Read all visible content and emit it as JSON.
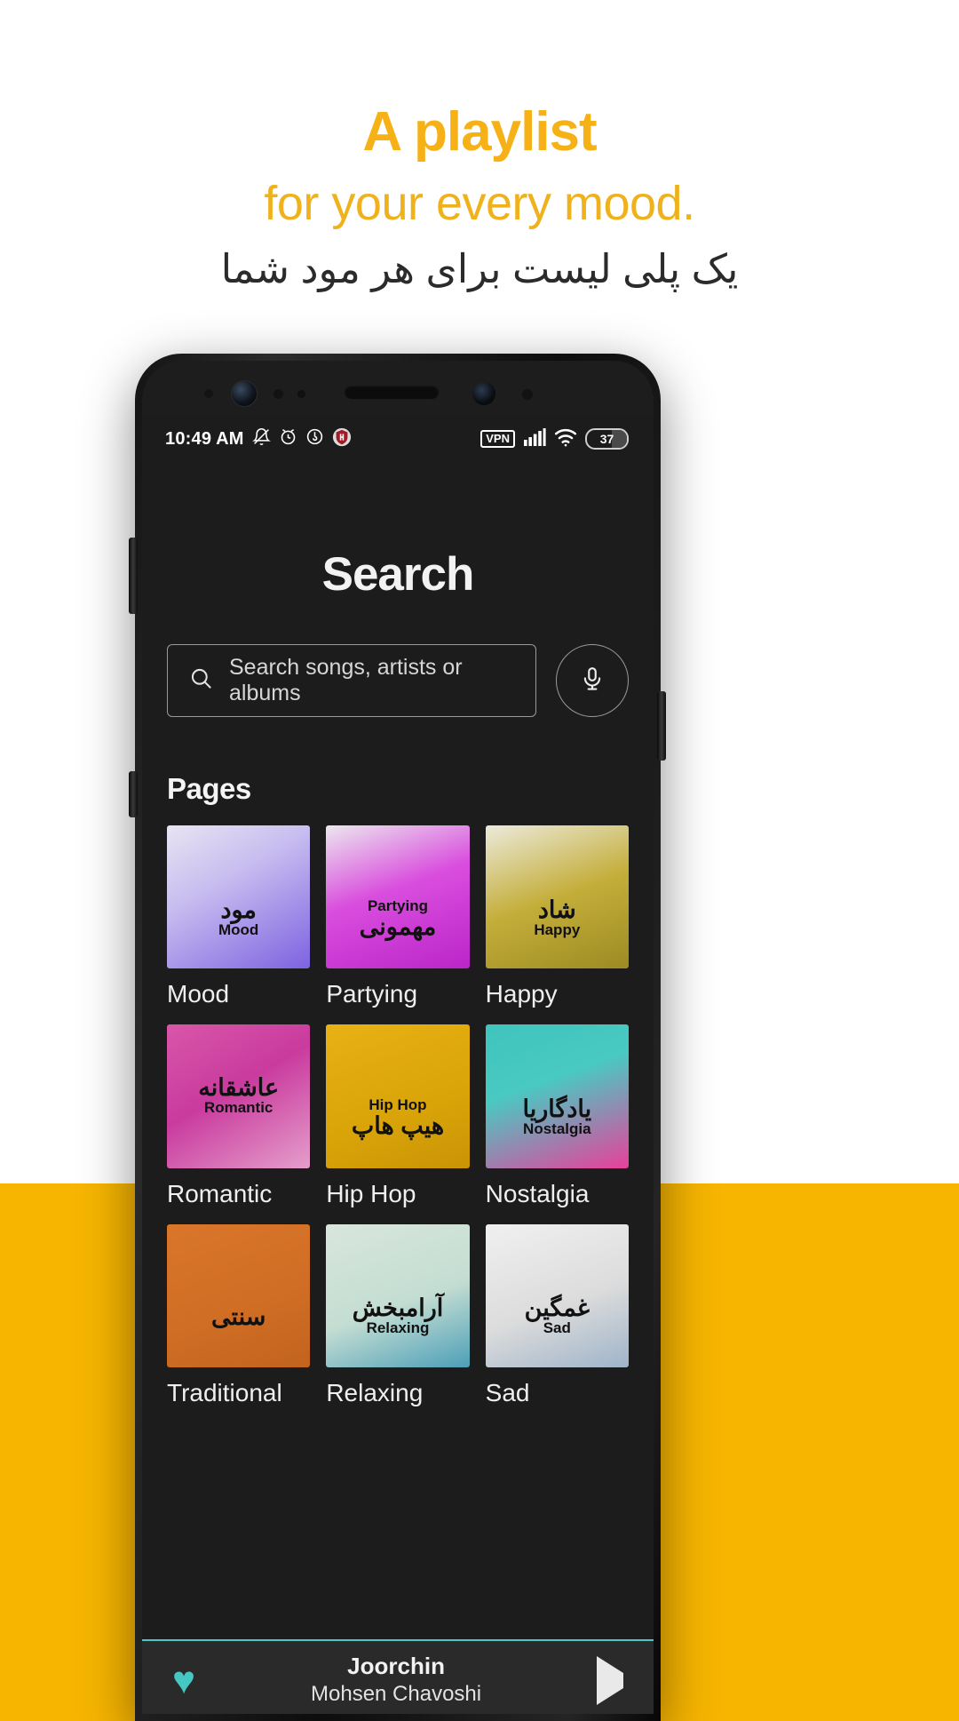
{
  "promo": {
    "line1": "A playlist",
    "line2": "for your every mood.",
    "line_fa": "یک پلی لیست برای هر مود شما",
    "accent_color": "#f5b116",
    "band_color": "#f7b500"
  },
  "status_bar": {
    "time": "10:49 AM",
    "icons_left": [
      "bell-muted-icon",
      "alarm-icon",
      "music-circle-icon",
      "shield-icon"
    ],
    "vpn_label": "VPN",
    "icons_right": [
      "signal-icon",
      "wifi-icon"
    ],
    "battery_percent": "37"
  },
  "screen": {
    "title": "Search",
    "search": {
      "placeholder": "Search songs, artists or albums",
      "value": "",
      "icon": "search-icon",
      "mic_icon": "microphone-icon"
    },
    "section_title": "Pages",
    "cards": [
      {
        "label": "Mood",
        "fa": "مود",
        "en": "Mood",
        "bg": "linear-gradient(150deg,#e8e4f2 0%,#c8bdf0 38%,#7d63e0 100%)",
        "shift": false
      },
      {
        "label": "Partying",
        "fa": "مهمونی",
        "en": "Partying",
        "bg": "linear-gradient(160deg,#ece7ee 0%,#d94ede 45%,#bb25c9 100%)",
        "shift": true
      },
      {
        "label": "Happy",
        "fa": "شاد",
        "en": "Happy",
        "bg": "linear-gradient(160deg,#eceadb 0%,#c4ae3a 50%,#9d8b23 100%)",
        "shift": false
      },
      {
        "label": "Romantic",
        "fa": "عاشقانه",
        "en": "Romantic",
        "bg": "linear-gradient(150deg,#d956a8 0%,#c93b9e 45%,#e59ecb 100%)",
        "shift": false
      },
      {
        "label": "Hip Hop",
        "fa": "هیپ هاپ",
        "en": "Hip Hop",
        "bg": "linear-gradient(160deg,#e8b114 0%,#d9a408 60%,#c99406 100%)",
        "shift": true
      },
      {
        "label": "Nostalgia",
        "fa": "یادگاریا",
        "en": "Nostalgia",
        "bg": "linear-gradient(160deg,#3fc4bd 0%,#49c9c2 40%,#e8409a 100%)",
        "shift": true
      },
      {
        "label": "Traditional",
        "fa": "سنتی",
        "en": "",
        "bg": "linear-gradient(160deg,#d9762a 0%,#cf6d24 60%,#c2631e 100%)",
        "shift": true
      },
      {
        "label": "Relaxing",
        "fa": "آرامبخش",
        "en": "Relaxing",
        "bg": "linear-gradient(160deg,#d9e6dd 0%,#c3ddd2 55%,#4d9fb8 100%)",
        "shift": true
      },
      {
        "label": "Sad",
        "fa": "غمگین",
        "en": "Sad",
        "bg": "linear-gradient(160deg,#f0f0f0 0%,#dcdcdc 55%,#9fb4c9 100%)",
        "shift": false
      }
    ]
  },
  "player": {
    "track_title": "Joorchin",
    "artist": "Mohsen Chavoshi",
    "like_icon": "heart-icon",
    "play_icon": "play-icon",
    "accent_color": "#45c8c2"
  }
}
